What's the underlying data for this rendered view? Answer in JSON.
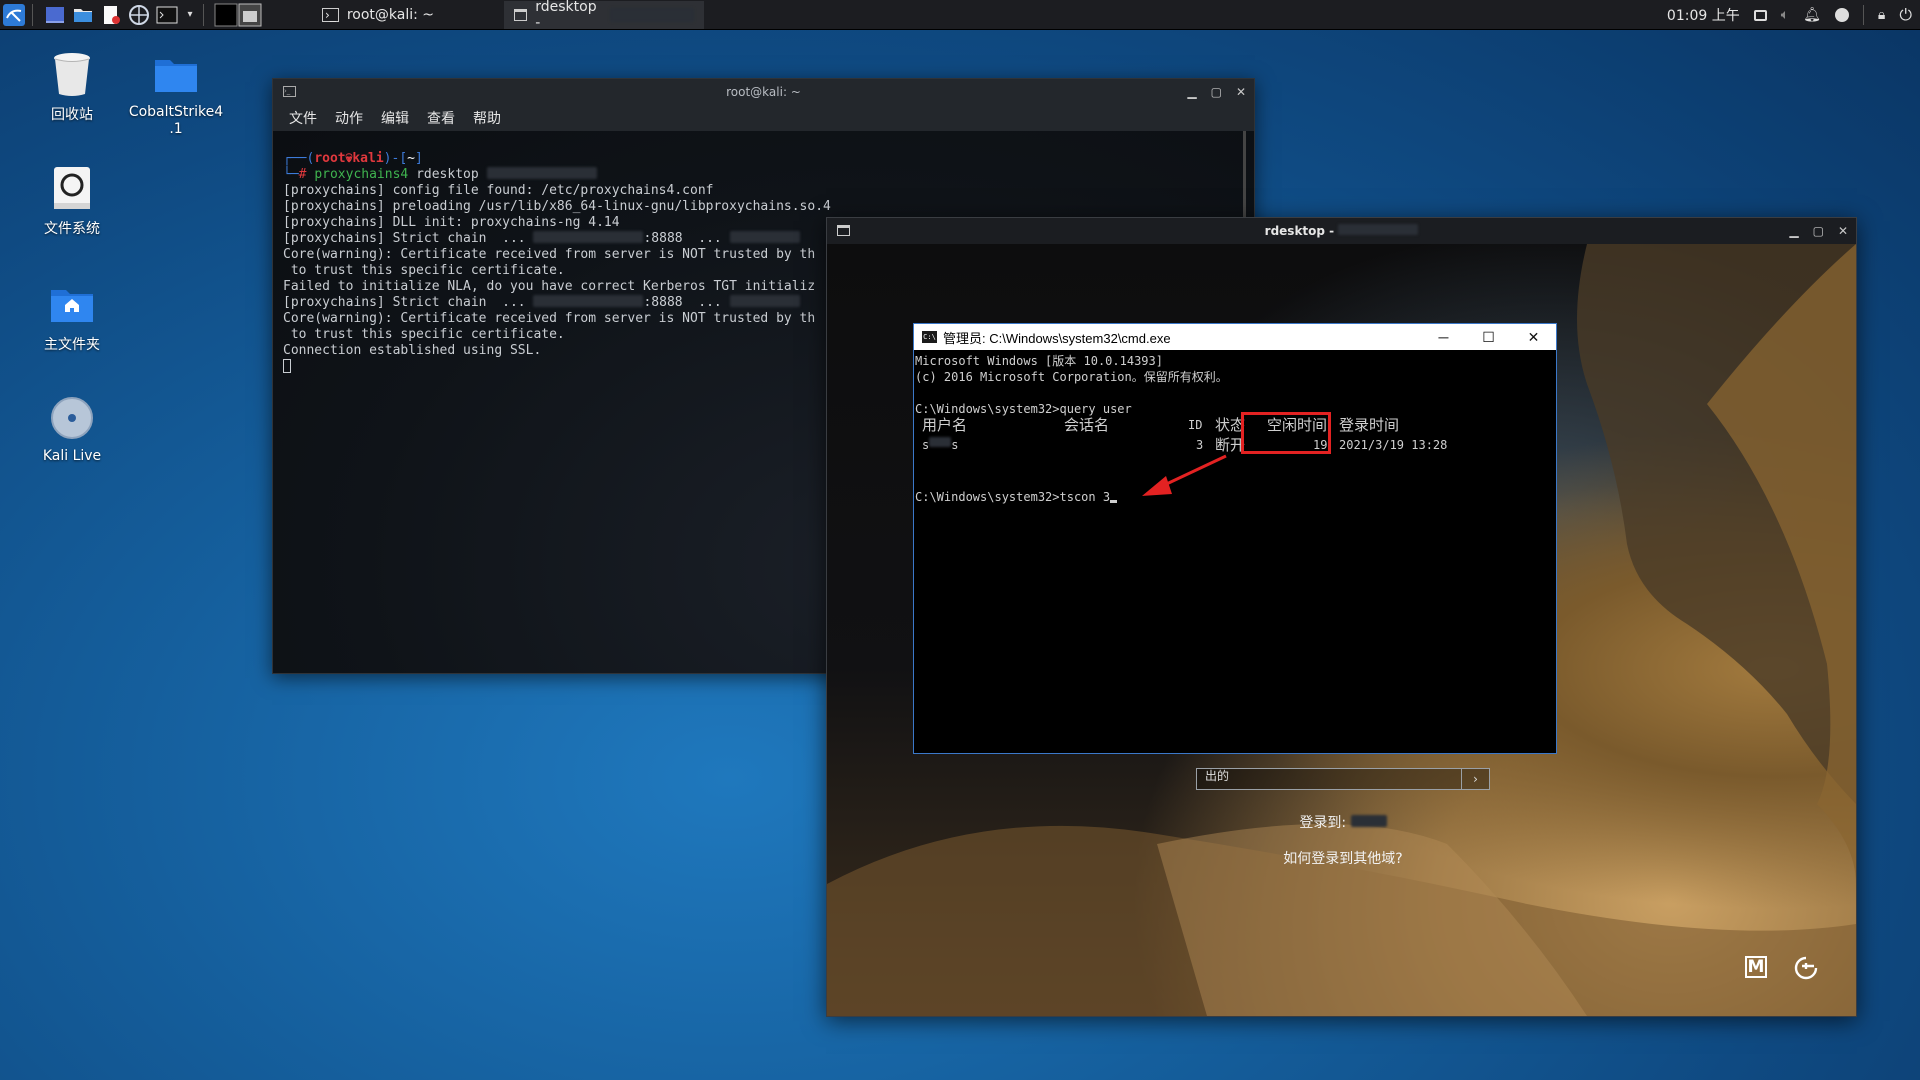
{
  "taskbar": {
    "tasks": [
      {
        "label": "root@kali: ~"
      },
      {
        "label": "rdesktop -"
      }
    ],
    "clock": "01:09 上午"
  },
  "desktop": {
    "icons": [
      {
        "label": "回收站",
        "icon": "trash-icon"
      },
      {
        "label": "CobaltStrike4\n.1",
        "icon": "folder-icon"
      },
      {
        "label": "文件系统",
        "icon": "drive-icon"
      },
      {
        "label": "主文件夹",
        "icon": "home-folder-icon"
      },
      {
        "label": "Kali Live",
        "icon": "disc-icon"
      }
    ]
  },
  "terminal": {
    "title": "root@kali: ~",
    "menu": [
      "文件",
      "动作",
      "编辑",
      "查看",
      "帮助"
    ],
    "prompt_user": "root",
    "prompt_host": "kali",
    "prompt_dir": "~",
    "command": "proxychains4",
    "command_args": "rdesktop",
    "lines": [
      "[proxychains] config file found: /etc/proxychains4.conf",
      "[proxychains] preloading /usr/lib/x86_64-linux-gnu/libproxychains.so.4",
      "[proxychains] DLL init: proxychains-ng 4.14",
      "[proxychains] Strict chain  ...",
      "Core(warning): Certificate received from server is NOT trusted by th",
      " to trust this specific certificate.",
      "Failed to initialize NLA, do you have correct Kerberos TGT initializ",
      "[proxychains] Strict chain  ...",
      "Core(warning): Certificate received from server is NOT trusted by th",
      " to trust this specific certificate.",
      "Connection established using SSL."
    ],
    "port_suffix": ":8888  ..."
  },
  "rdesktop": {
    "title": "rdesktop -",
    "login_to": "登录到: ",
    "other_domain": "如何登录到其他域?",
    "input_partial": "出的"
  },
  "cmd": {
    "title": "管理员: C:\\Windows\\system32\\cmd.exe",
    "lines": [
      "Microsoft Windows [版本 10.0.14393]",
      "(c) 2016 Microsoft Corporation。保留所有权利。",
      "",
      "C:\\Windows\\system32>query user"
    ],
    "headers": {
      "user": "用户名",
      "session": "会话名",
      "id": "ID",
      "state": "状态",
      "idle": "空闲时间",
      "logon": "登录时间"
    },
    "row": {
      "user": "s",
      "user_tail": "s",
      "id": "3",
      "state": "断开",
      "idle": "19",
      "logon": "2021/3/19 13:28"
    },
    "command_line": "C:\\Windows\\system32>tscon 3"
  },
  "colors": {
    "annotation": "#e32222",
    "prompt_red": "#e0383d",
    "prompt_blue": "#3d7bd9",
    "cmd_green": "#3fb34f"
  }
}
